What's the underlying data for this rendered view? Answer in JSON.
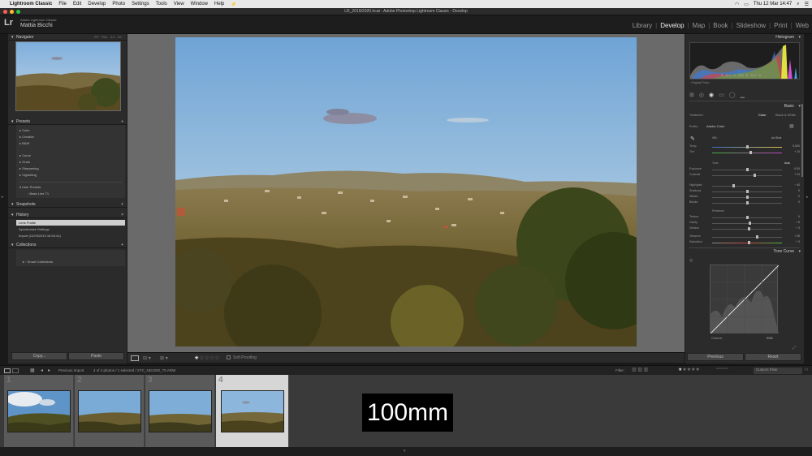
{
  "menubar": {
    "app_name": "Lightroom Classic",
    "items": [
      "File",
      "Edit",
      "Develop",
      "Photo",
      "Settings",
      "Tools",
      "View",
      "Window",
      "Help"
    ],
    "clock": "Thu 12 Mar  14:47"
  },
  "window": {
    "title": "LR_2019/2020.lrcat - Adobe Photoshop Lightroom Classic - Develop"
  },
  "identity": {
    "logo": "Lr",
    "catalog_label": "Adobe Lightroom Classic",
    "user": "Mattia Bicchi"
  },
  "modules": [
    "Library",
    "Develop",
    "Map",
    "Book",
    "Slideshow",
    "Print",
    "Web"
  ],
  "active_module": "Develop",
  "left": {
    "navigator": {
      "title": "Navigator",
      "zoom": [
        "FIT",
        "FILL",
        "1:1",
        "4:1"
      ]
    },
    "presets": {
      "title": "Presets",
      "items": [
        "Color",
        "Creative",
        "B&W",
        "Curve",
        "Grain",
        "Sharpening",
        "Vignetting",
        "User Presets",
        "Base Line T1"
      ]
    },
    "snapshots": {
      "title": "Snapshots"
    },
    "history": {
      "title": "History",
      "items": [
        "Lens Profile",
        "Synchronize Settings",
        "Import (12/09/2019 16:54:41)"
      ]
    },
    "collections": {
      "title": "Collections",
      "items": [
        "Smart Collections"
      ]
    },
    "copy_label": "Copy...",
    "paste_label": "Paste"
  },
  "toolbar": {
    "soft_proofing": "Soft Proofing"
  },
  "right": {
    "histogram": {
      "title": "Histogram",
      "readout": [
        "R",
        "41.1",
        "G",
        "36.6",
        "B",
        "22.3",
        "%"
      ],
      "original_photo": "Original Photo"
    },
    "basic": {
      "title": "Basic",
      "treatment_label": "Treatment :",
      "treatment_color": "Color",
      "treatment_bw": "Black & White",
      "profile_label": "Profile :",
      "profile_value": "Adobe Color",
      "wb_label": "WB :",
      "wb_value": "As Shot",
      "tone_label": "Tone",
      "tone_auto": "Auto",
      "presence_label": "Presence",
      "sliders": [
        {
          "label": "Temp",
          "value": "5,500",
          "pos": 0.5
        },
        {
          "label": "Tint",
          "value": "+ 10",
          "pos": 0.55
        },
        {
          "label": "Exposure",
          "value": "0.00",
          "pos": 0.5
        },
        {
          "label": "Contrast",
          "value": "+ 24",
          "pos": 0.6
        },
        {
          "label": "Highlights",
          "value": "− 40",
          "pos": 0.3
        },
        {
          "label": "Shadows",
          "value": "0",
          "pos": 0.5
        },
        {
          "label": "Whites",
          "value": "0",
          "pos": 0.5
        },
        {
          "label": "Blacks",
          "value": "0",
          "pos": 0.5
        },
        {
          "label": "Texture",
          "value": "0",
          "pos": 0.5
        },
        {
          "label": "Clarity",
          "value": "+ 5",
          "pos": 0.53
        },
        {
          "label": "Dehaze",
          "value": "+ 3",
          "pos": 0.52
        },
        {
          "label": "Vibrance",
          "value": "+ 28",
          "pos": 0.64
        },
        {
          "label": "Saturation",
          "value": "+ 3",
          "pos": 0.52
        }
      ]
    },
    "tone_curve": {
      "title": "Tone Curve",
      "channel_label": "Channel :",
      "channel_value": "RGB"
    },
    "previous_label": "Previous",
    "reset_label": "Reset"
  },
  "filmstrip_bar": {
    "source": "Previous Import",
    "info": "4 of 4 photos / 1 selected / STC_ND1000_70.ARW",
    "filter_label": "Filter :",
    "custom_filter": "Custom Filter"
  },
  "filmstrip": {
    "numbers": [
      "1",
      "2",
      "3",
      "4"
    ]
  },
  "overlay": {
    "text": "100mm"
  },
  "colors": {
    "accent": "#e8e8e8",
    "panel": "#2b2b2b",
    "sky": "#8fb8dc"
  }
}
